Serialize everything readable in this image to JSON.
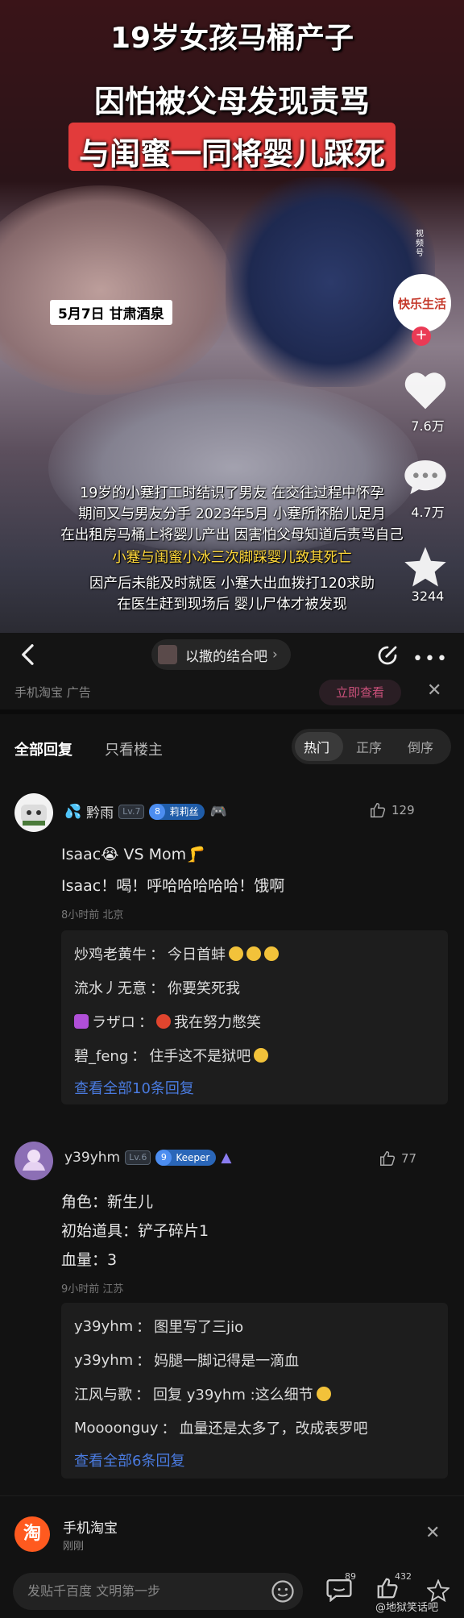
{
  "video": {
    "title_line1": "19岁女孩马桶产子",
    "title_line2": "因怕被父母发现责骂",
    "title_line3": "与闺蜜一同将婴儿踩死",
    "location_tag": "5月7日 甘肃酒泉",
    "subtitles": [
      "19岁的小蹇打工时结识了男友 在交往过程中怀孕",
      "期间又与男友分手 2023年5月 小蹇所怀胎儿足月",
      "在出租房马桶上将婴儿产出 因害怕父母知道后责骂自己",
      "小蹇与闺蜜小冰三次脚踩婴儿致其死亡",
      "因产后未能及时就医 小蹇大出血拨打120求助",
      "在医生赶到现场后 婴儿尸体才被发现"
    ],
    "channel_tag": "视频号",
    "avatar_text": "快乐生活",
    "like_count": "7.6万",
    "comment_count": "4.7万",
    "star_count": "3244",
    "accent_red": "#e23b3b",
    "highlight_yellow": "#ffd83a"
  },
  "topbar": {
    "forum_name": "以撒的结合吧",
    "chevron": "›",
    "more": "•••"
  },
  "ad": {
    "label": "手机淘宝 广告",
    "button": "立即查看",
    "close": "✕"
  },
  "filters": {
    "all": "全部回复",
    "op_only": "只看楼主",
    "sort": [
      "热门",
      "正序",
      "倒序"
    ]
  },
  "comments": [
    {
      "user": "黔雨",
      "level": "Lv.7",
      "badge_num": "8",
      "badge_text": "莉莉丝",
      "likes": "129",
      "lines": [
        "Isaac😭 VS Mom🦵",
        "Isaac！喝！呼哈哈哈哈哈！饿啊"
      ],
      "meta": "8小时前  北京",
      "replies": [
        {
          "user": "炒鸡老黄牛",
          "text": "今日首蚌"
        },
        {
          "user": "流水丿无意",
          "text": "你要笑死我"
        },
        {
          "user": "ラザロ",
          "text": "我在努力憋笑"
        },
        {
          "user": "碧_feng",
          "text": "住手这不是狱吧"
        }
      ],
      "more": "查看全部10条回复"
    },
    {
      "user": "y39yhm",
      "level": "Lv.6",
      "badge_num": "9",
      "badge_text": "Keeper",
      "likes": "77",
      "lines": [
        "角色：新生儿",
        "初始道具：铲子碎片1",
        "血量：3"
      ],
      "meta": "9小时前  江苏",
      "replies": [
        {
          "user": "y39yhm",
          "text": "图里写了三jio"
        },
        {
          "user": "y39yhm",
          "text": "妈腿一脚记得是一滴血"
        },
        {
          "user": "江风与歌",
          "text": "回复 y39yhm :这么细节"
        },
        {
          "user": "Moooonguy",
          "text": "血量还是太多了，改成表罗吧"
        }
      ],
      "more": "查看全部6条回复"
    }
  ],
  "notification": {
    "logo": "淘",
    "name": "手机淘宝",
    "time": "刚刚"
  },
  "bottombar": {
    "placeholder": "发贴千百度 文明第一步",
    "comment_count": "89",
    "like_count": "432",
    "watermark": "@地狱笑话吧"
  }
}
